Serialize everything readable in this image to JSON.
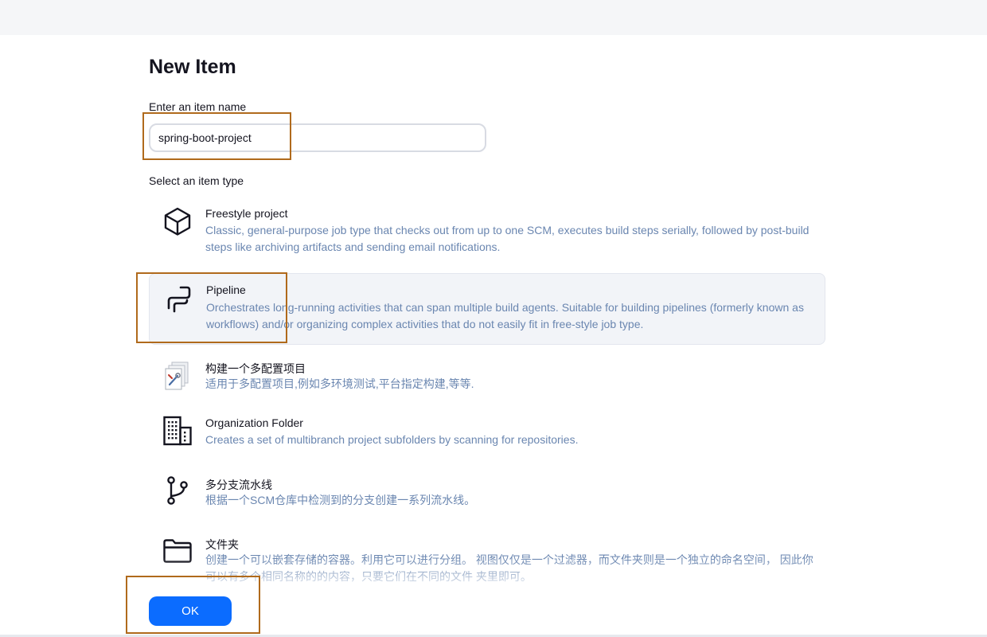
{
  "page": {
    "title": "New Item",
    "name_label": "Enter an item name",
    "name_value": "spring-boot-project",
    "type_label": "Select an item type",
    "ok_label": "OK"
  },
  "item_types": [
    {
      "name": "Freestyle project",
      "description": "Classic, general-purpose job type that checks out from up to one SCM, executes build steps serially, followed by post-build steps like archiving artifacts and sending email notifications.",
      "icon": "cube-icon",
      "selected": false
    },
    {
      "name": "Pipeline",
      "description": "Orchestrates long-running activities that can span multiple build agents. Suitable for building pipelines (formerly known as workflows) and/or organizing complex activities that do not easily fit in free-style job type.",
      "icon": "pipeline-icon",
      "selected": true
    },
    {
      "name": "构建一个多配置项目",
      "description": "适用于多配置项目,例如多环境测试,平台指定构建,等等.",
      "icon": "multi-config-icon",
      "selected": false
    },
    {
      "name": "Organization Folder",
      "description": "Creates a set of multibranch project subfolders by scanning for repositories.",
      "icon": "building-icon",
      "selected": false
    },
    {
      "name": "多分支流水线",
      "description": "根据一个SCM仓库中检测到的分支创建一系列流水线。",
      "icon": "branch-icon",
      "selected": false
    },
    {
      "name": "文件夹",
      "description": "创建一个可以嵌套存储的容器。利用它可以进行分组。 视图仅仅是一个过滤器，而文件夹则是一个独立的命名空间， 因此你可以有多个相同名称的的内容，只要它们在不同的文件 夹里即可。",
      "icon": "folder-icon",
      "selected": false
    }
  ],
  "colors": {
    "accent": "#0b6cff",
    "description": "#6a86b0",
    "highlight": "#b06a1c",
    "selected_bg": "#f2f4f8"
  }
}
